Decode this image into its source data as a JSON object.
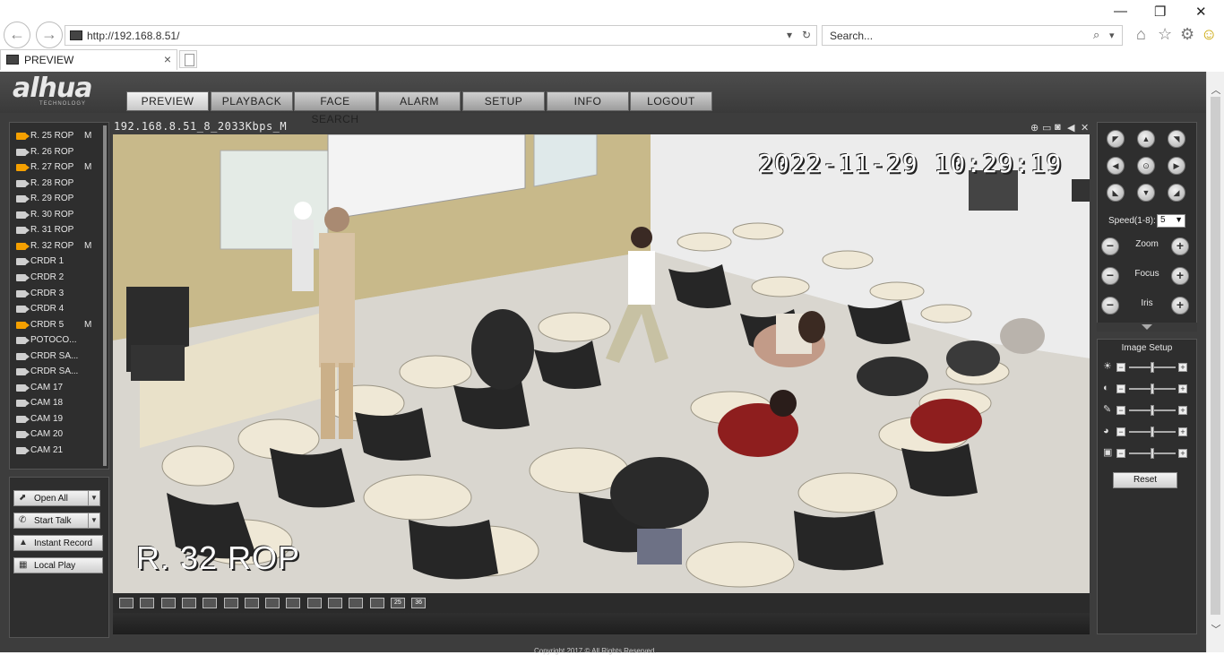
{
  "browser": {
    "url": "http://192.168.8.51/",
    "search_placeholder": "Search...",
    "tab_title": "PREVIEW",
    "tab_close": "×",
    "back_icon": "←",
    "forward_icon": "→",
    "dropdown_icon": "▾",
    "refresh_icon": "↻",
    "search_icon": "⌕",
    "home_icon": "⌂",
    "star_icon": "☆",
    "gear_icon": "⚙",
    "smiley_icon": "☺",
    "minimize": "—",
    "restore": "❐",
    "close": "✕"
  },
  "app": {
    "logo": "alhua",
    "logo_sub": "TECHNOLOGY",
    "menu": [
      "PREVIEW",
      "PLAYBACK",
      "FACE SEARCH",
      "ALARM",
      "SETUP",
      "INFO",
      "LOGOUT"
    ],
    "active_menu": "PREVIEW"
  },
  "cameras": [
    {
      "label": "R. 25 ROP",
      "flag": "M",
      "live": true
    },
    {
      "label": "R. 26 ROP",
      "flag": "",
      "live": false
    },
    {
      "label": "R. 27 ROP",
      "flag": "M",
      "live": true
    },
    {
      "label": "R. 28 ROP",
      "flag": "",
      "live": false
    },
    {
      "label": "R. 29 ROP",
      "flag": "",
      "live": false
    },
    {
      "label": "R. 30 ROP",
      "flag": "",
      "live": false
    },
    {
      "label": "R. 31 ROP",
      "flag": "",
      "live": false
    },
    {
      "label": "R. 32 ROP",
      "flag": "M",
      "live": true
    },
    {
      "label": "CRDR 1",
      "flag": "",
      "live": false
    },
    {
      "label": "CRDR 2",
      "flag": "",
      "live": false
    },
    {
      "label": "CRDR 3",
      "flag": "",
      "live": false
    },
    {
      "label": "CRDR 4",
      "flag": "",
      "live": false
    },
    {
      "label": "CRDR 5",
      "flag": "M",
      "live": true
    },
    {
      "label": "POTOCO...",
      "flag": "",
      "live": false
    },
    {
      "label": "CRDR SA...",
      "flag": "",
      "live": false
    },
    {
      "label": "CRDR SA...",
      "flag": "",
      "live": false
    },
    {
      "label": "CAM 17",
      "flag": "",
      "live": false
    },
    {
      "label": "CAM 18",
      "flag": "",
      "live": false
    },
    {
      "label": "CAM 19",
      "flag": "",
      "live": false
    },
    {
      "label": "CAM 20",
      "flag": "",
      "live": false
    },
    {
      "label": "CAM 21",
      "flag": "",
      "live": false
    }
  ],
  "left_buttons": {
    "open_all": "Open All",
    "start_talk": "Start Talk",
    "instant_record": "Instant Record",
    "local_play": "Local Play",
    "dropdown": "▼"
  },
  "video": {
    "title": "192.168.8.51_8_2033Kbps_M",
    "osd_time": "2022-11-29 10:29:19",
    "osd_name": "R. 32 ROP",
    "toolbar_icons": [
      "zoom-icon",
      "fullscreen-icon",
      "snapshot-icon",
      "audio-icon",
      "close-icon"
    ]
  },
  "layout_buttons": [
    "",
    "",
    "",
    "",
    "",
    "",
    "",
    "",
    "",
    "",
    "",
    "",
    "",
    "25",
    "36"
  ],
  "ptz": {
    "speed_label": "Speed(1-8):",
    "speed_value": "5",
    "zoom": "Zoom",
    "focus": "Focus",
    "iris": "Iris",
    "minus": "−",
    "plus": "+"
  },
  "image_setup": {
    "title": "Image Setup",
    "reset": "Reset",
    "sliders": [
      {
        "name": "brightness",
        "level": 0.5
      },
      {
        "name": "contrast",
        "level": 0.5
      },
      {
        "name": "saturation",
        "level": 0.5
      },
      {
        "name": "hue",
        "level": 0.5
      },
      {
        "name": "gamma",
        "level": 0.5
      }
    ]
  },
  "footer": "Copyright 2017 © All Rights Reserved."
}
